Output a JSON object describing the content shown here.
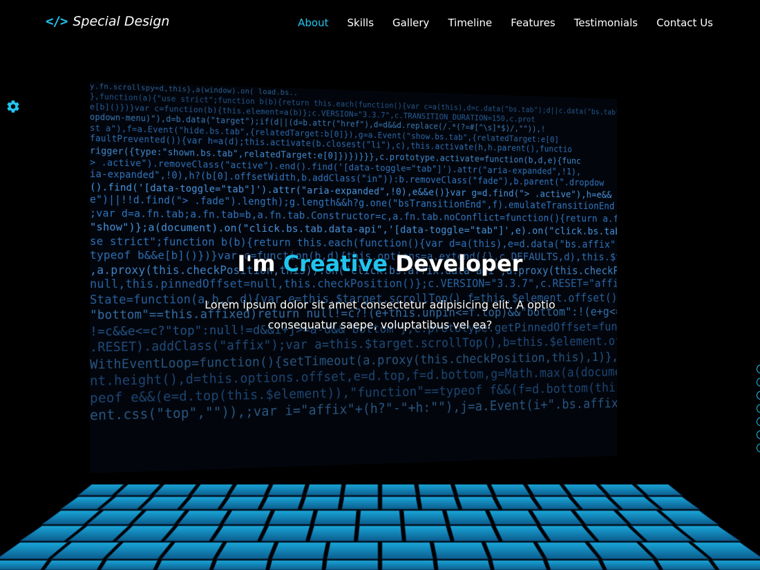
{
  "brand": {
    "icon": "code-brackets-icon",
    "icon_glyph": "</>",
    "name": "Special Design",
    "accent_color": "#21c4ef"
  },
  "nav": {
    "items": [
      {
        "label": "About",
        "active": true
      },
      {
        "label": "Skills",
        "active": false
      },
      {
        "label": "Gallery",
        "active": false
      },
      {
        "label": "Timeline",
        "active": false
      },
      {
        "label": "Features",
        "active": false
      },
      {
        "label": "Testimonials",
        "active": false
      },
      {
        "label": "Contact Us",
        "active": false
      }
    ]
  },
  "settings": {
    "icon": "gear-icon"
  },
  "hero": {
    "title_prefix": "I'm ",
    "title_accent": "Creative",
    "title_suffix": " Developer",
    "description": "Lorem ipsum dolor sit amet consectetur adipisicing elit. A optio consequatur saepe, voluptatibus vel ea?"
  },
  "side_bullets": {
    "count": 7
  },
  "background_code": [
    "y.fn.scrollspy=d,this},a(window).on( load.bs..",
    "},function(a){\"use strict\";function b(b){return this.each(function(){var c=a(this),d=c.data(\"bs.tab\");d||c.data(\"bs.tab\",d=new c(this)),\"string\"==typeof b&&d[b]()})}",
    "e[b]()})}var c=function(b){this.element=a(b)};c.VERSION=\"3.3.7\",c.TRANSITION_DURATION=150,c.prot",
    "opdown-menu)\"),d=b.data(\"target\");if(d||(d=b.attr(\"href\"),d=d&&d.replace(/.*(?=#[^\\s]*$)/,\"\")),!",
    "st a\"),f=a.Event(\"hide.bs.tab\",{relatedTarget:b[0]}),g=a.Event(\"show.bs.tab\",{relatedTarget:e[0]",
    "faultPrevented()){var h=a(d);this.activate(b.closest(\"li\"),c),this.activate(h,h.parent(),functio",
    "rigger({type:\"shown.bs.tab\",relatedTarget:e[0]})})}}},c.prototype.activate=function(b,d,e){func",
    "> .active\").removeClass(\"active\").end().find('[data-toggle=\"tab\"]').attr(\"aria-expanded\",!1),",
    "ia-expanded\",!0),h?(b[0].offsetWidth,b.addClass(\"in\")):b.removeClass(\"fade\"),b.parent(\".dropdow",
    "().find('[data-toggle=\"tab\"]').attr(\"aria-expanded\",!0),e&&e()}var g=d.find(\"> .active\"),h=e&&",
    "e\")||!!d.find(\"> .fade\").length);g.length&&h?g.one(\"bsTransitionEnd\",f).emulateTransitionEnd",
    ";var d=a.fn.tab;a.fn.tab=b,a.fn.tab.Constructor=c,a.fn.tab.noConflict=function(){return a.fn.t",
    "\"show\")};a(document).on(\"click.bs.tab.data-api\",'[data-toggle=\"tab\"]',e).on(\"click.bs.tab.data",
    "se strict\";function b(b){return this.each(function(){var d=a(this),e=d.data(\"bs.affix\"),f=\"obj",
    "typeof b&&e[b]()})}var c=function(b,d){this.options=a.extend({},c.DEFAULTS,d),this.$target=a",
    ",a.proxy(this.checkPosition,this)).on(\"click.bs.affix.data-api\",a.proxy(this.checkPositionWi",
    "null,this.pinnedOffset=null,this.checkPosition()};c.VERSION=\"3.3.7\",c.RESET=\"affix affix-top",
    "State=function(a,b,c,d){var e=this.$target.scrollTop(),f=this.$element.offset(),g=this.$targ",
    "\"bottom\"==this.affixed)return null!=c?!(e+this.unpin<=f.top)&&\"bottom\":!(e+g<=a-d)&&\"bottom\"",
    "!=c&&e<=c?\"top\":null!=d&&i+j>=a-d&&\"bottom\"},c.prototype.getPinnedOffset=function(){if(this",
    ".RESET).addClass(\"affix\");var a=this.$target.scrollTop(),b=this.$element.offset();return",
    "WithEventLoop=function(){setTimeout(a.proxy(this.checkPosition,this),1)},c.prototype.checkPos",
    "nt.height(),d=this.options.offset,e=d.top,f=d.bottom,g=Math.max(a(document).height(),a(docu",
    "peof e&&(e=d.top(this.$element)),\"function\"==typeof f&&(f=d.bottom(this.$element));var h=th",
    "ent.css(\"top\",\"\")),;var i=\"affix\"+(h?\"-\"+h:\"\"),j=a.Event(i+\".bs.affix\");this.$element.trigg"
  ]
}
